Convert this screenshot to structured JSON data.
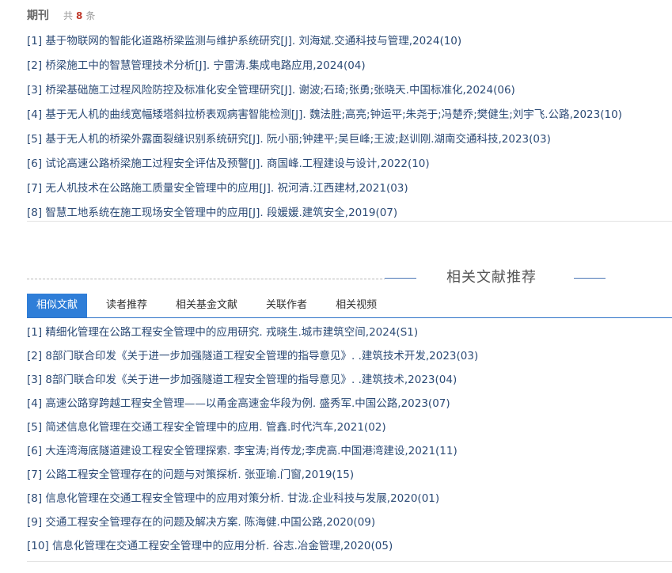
{
  "journal": {
    "title": "期刊",
    "count_prefix": "共",
    "count": "8",
    "count_suffix": "条",
    "items": [
      "[1] 基于物联网的智能化道路桥梁监测与维护系统研究[J]. 刘海斌.交通科技与管理,2024(10)",
      "[2] 桥梁施工中的智慧管理技术分析[J]. 宁雷涛.集成电路应用,2024(04)",
      "[3] 桥梁基础施工过程风险防控及标准化安全管理研究[J]. 谢波;石琦;张勇;张晓天.中国标准化,2024(06)",
      "[4] 基于无人机的曲线宽幅矮塔斜拉桥表观病害智能检测[J]. 魏法胜;高亮;钟运平;朱尧于;冯楚乔;樊健生;刘宇飞.公路,2023(10)",
      "[5] 基于无人机的桥梁外露面裂缝识别系统研究[J]. 阮小丽;钟建平;吴巨峰;王波;赵训刚.湖南交通科技,2023(03)",
      "[6] 试论高速公路桥梁施工过程安全评估及预警[J]. 商国峰.工程建设与设计,2022(10)",
      "[7] 无人机技术在公路施工质量安全管理中的应用[J]. 祝河清.江西建材,2021(03)",
      "[8] 智慧工地系统在施工现场安全管理中的应用[J]. 段媛媛.建筑安全,2019(07)"
    ]
  },
  "recommend": {
    "title": "相关文献推荐",
    "tabs": [
      "相似文献",
      "读者推荐",
      "相关基金文献",
      "关联作者",
      "相关视频"
    ],
    "active_tab": 0,
    "items": [
      "[1] 精细化管理在公路工程安全管理中的应用研究. 戎晓生.城市建筑空间,2024(S1)",
      "[2] 8部门联合印发《关于进一步加强隧道工程安全管理的指导意见》. .建筑技术开发,2023(03)",
      "[3] 8部门联合印发《关于进一步加强隧道工程安全管理的指导意见》. .建筑技术,2023(04)",
      "[4] 高速公路穿跨越工程安全管理——以甬金高速金华段为例. 盛秀军.中国公路,2023(07)",
      "[5] 简述信息化管理在交通工程安全管理中的应用. 管鑫.时代汽车,2021(02)",
      "[6] 大连湾海底隧道建设工程安全管理探索. 李宝涛;肖传龙;李虎高.中国港湾建设,2021(11)",
      "[7] 公路工程安全管理存在的问题与对策探析. 张亚瑜.门窗,2019(15)",
      "[8] 信息化管理在交通工程安全管理中的应用对策分析. 甘泷.企业科技与发展,2020(01)",
      "[9] 交通工程安全管理存在的问题及解决方案. 陈海健.中国公路,2020(09)",
      "[10] 信息化管理在交通工程安全管理中的应用分析. 谷志.冶金管理,2020(05)"
    ]
  }
}
